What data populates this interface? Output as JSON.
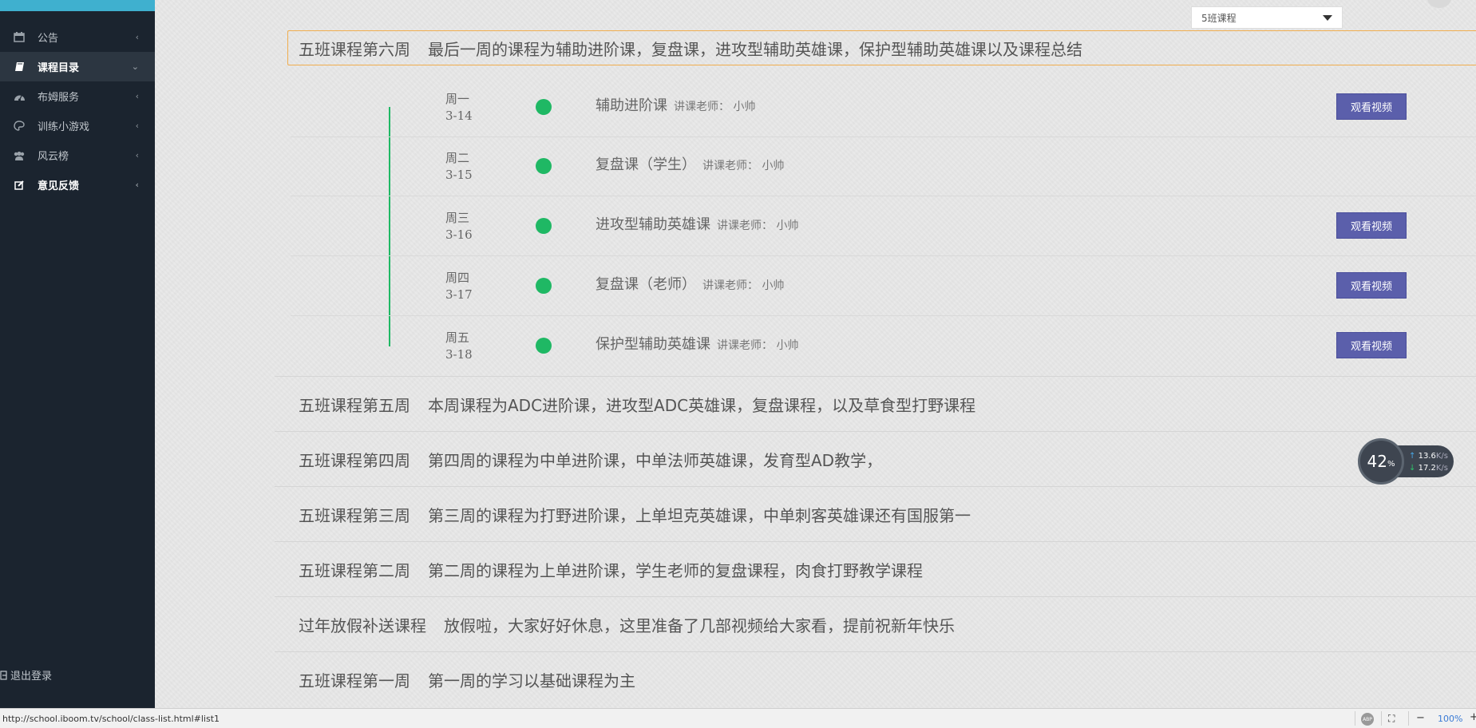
{
  "sidebar": {
    "items": [
      {
        "label": "公告",
        "icon": "calendar-icon"
      },
      {
        "label": "课程目录",
        "icon": "book-icon"
      },
      {
        "label": "布姆服务",
        "icon": "dashboard-icon"
      },
      {
        "label": "训练小游戏",
        "icon": "palette-icon"
      },
      {
        "label": "风云榜",
        "icon": "users-icon"
      },
      {
        "label": "意见反馈",
        "icon": "edit-icon"
      }
    ],
    "logout": "退出登录"
  },
  "class_select": {
    "value": "5班课程"
  },
  "open_week": {
    "name": "五班课程第六周",
    "desc": "最后一周的课程为辅助进阶课，复盘课，进攻型辅助英雄课，保护型辅助英雄课以及课程总结"
  },
  "teacher_prefix": "讲课老师：",
  "days": [
    {
      "weekday": "周一",
      "date": "3-14",
      "course": "辅助进阶课",
      "teacher": "讲课老师：  小帅",
      "button": "观看视频"
    },
    {
      "weekday": "周二",
      "date": "3-15",
      "course": "复盘课（学生）",
      "teacher": "讲课老师：  小帅",
      "button": ""
    },
    {
      "weekday": "周三",
      "date": "3-16",
      "course": "进攻型辅助英雄课",
      "teacher": "讲课老师：  小帅",
      "button": "观看视频"
    },
    {
      "weekday": "周四",
      "date": "3-17",
      "course": "复盘课（老师）",
      "teacher": "讲课老师：  小帅",
      "button": "观看视频"
    },
    {
      "weekday": "周五",
      "date": "3-18",
      "course": "保护型辅助英雄课",
      "teacher": "讲课老师：  小帅",
      "button": "观看视频"
    }
  ],
  "weeks": [
    {
      "name": "五班课程第五周",
      "desc": "本周课程为ADC进阶课，进攻型ADC英雄课，复盘课程，以及草食型打野课程"
    },
    {
      "name": "五班课程第四周",
      "desc": "第四周的课程为中单进阶课，中单法师英雄课，发育型AD教学，"
    },
    {
      "name": "五班课程第三周",
      "desc": "第三周的课程为打野进阶课，上单坦克英雄课，中单刺客英雄课还有国服第一"
    },
    {
      "name": "五班课程第二周",
      "desc": "第二周的课程为上单进阶课，学生老师的复盘课程，肉食打野教学课程"
    },
    {
      "name": "过年放假补送课程",
      "desc": "放假啦，大家好好休息，这里准备了几部视频给大家看，提前祝新年快乐"
    },
    {
      "name": "五班课程第一周",
      "desc": "第一周的学习以基础课程为主"
    }
  ],
  "net_widget": {
    "percent": "42",
    "percent_sign": "%",
    "up": "13.6",
    "down": "17.2",
    "unit": "K/s"
  },
  "statusbar": {
    "url": "http://school.iboom.tv/school/class-list.html#list1",
    "abp": "ABP",
    "zoom": "100%"
  },
  "colors": {
    "sidebar_bg": "#1b242f",
    "accent_top": "#3fb0cf",
    "timeline_green": "#1fb864",
    "button_purple": "#5b5fab",
    "open_border": "#f0ad4e"
  }
}
